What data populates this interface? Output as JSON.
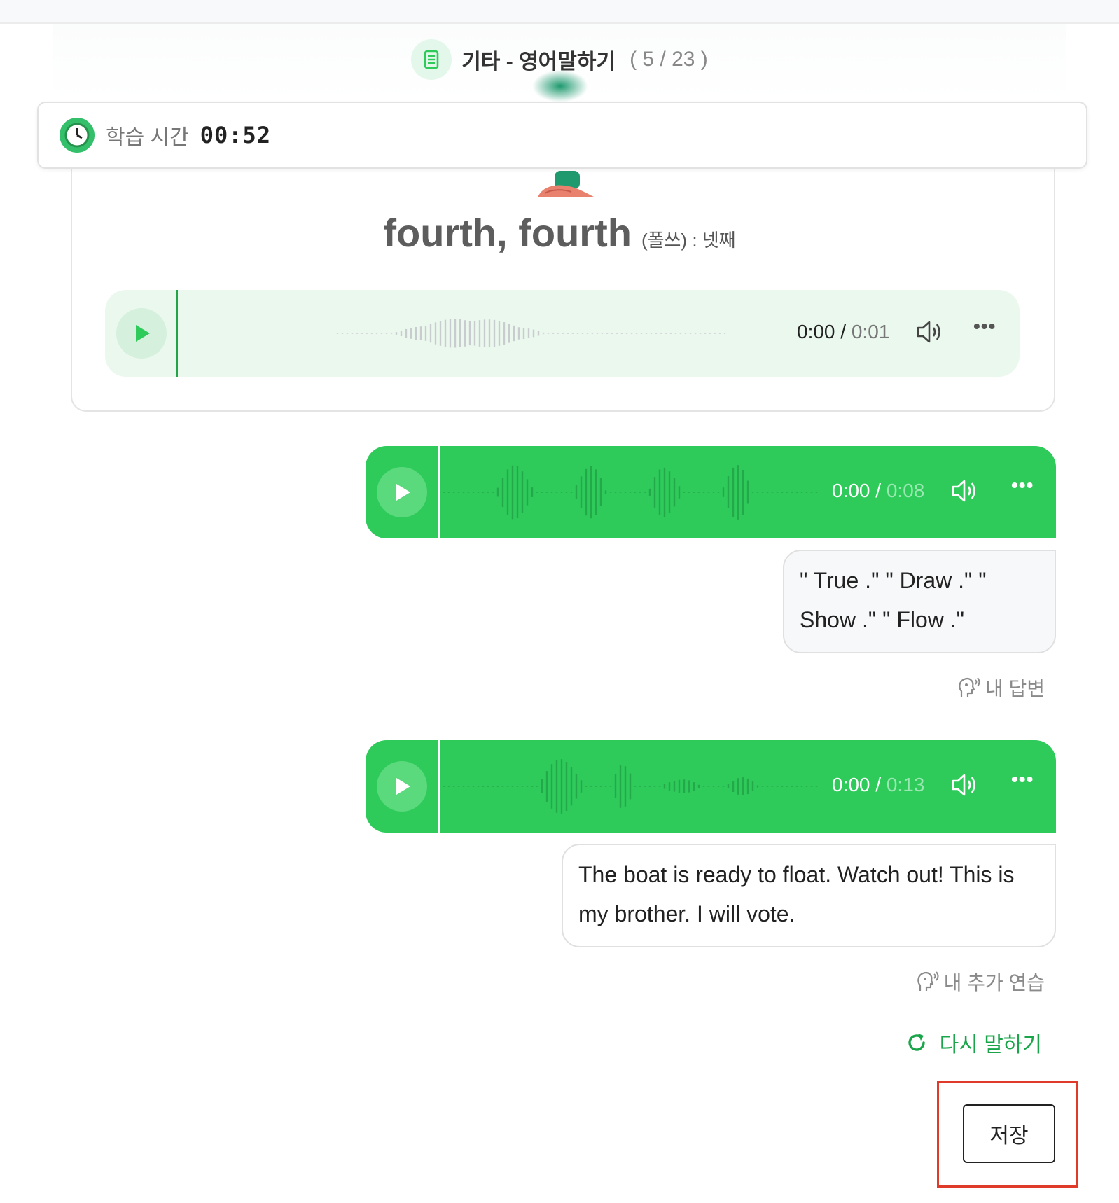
{
  "header": {
    "title": "기타 - 영어말하기",
    "count": "( 5 / 23 )"
  },
  "timer": {
    "label": "학습 시간",
    "value": "00:52"
  },
  "word": {
    "text": "fourth, fourth",
    "meaning": "(폴쓰) : 넷째"
  },
  "sample_audio": {
    "current": "0:00",
    "separator": " / ",
    "total": "0:01"
  },
  "answers": [
    {
      "audio": {
        "current": "0:00",
        "separator": " / ",
        "total": "0:08"
      },
      "text": "\" True .\" \" Draw .\" \" Show .\" \" Flow .\"",
      "caption": "내 답변"
    },
    {
      "audio": {
        "current": "0:00",
        "separator": " / ",
        "total": "0:13"
      },
      "text": "The boat is ready to float. Watch out! This is my brother. I will vote.",
      "caption": "내 추가 연습"
    }
  ],
  "retry_label": "다시 말하기",
  "save_label": "저장",
  "colors": {
    "accent_green": "#2ecb5b",
    "light_green": "#eaf8ee",
    "retry_green": "#1aa54a",
    "highlight_red": "#e03a2a"
  },
  "icons": [
    "document-icon",
    "clock-icon",
    "play-icon",
    "volume-icon",
    "more-icon",
    "speaking-head-icon",
    "refresh-icon"
  ]
}
